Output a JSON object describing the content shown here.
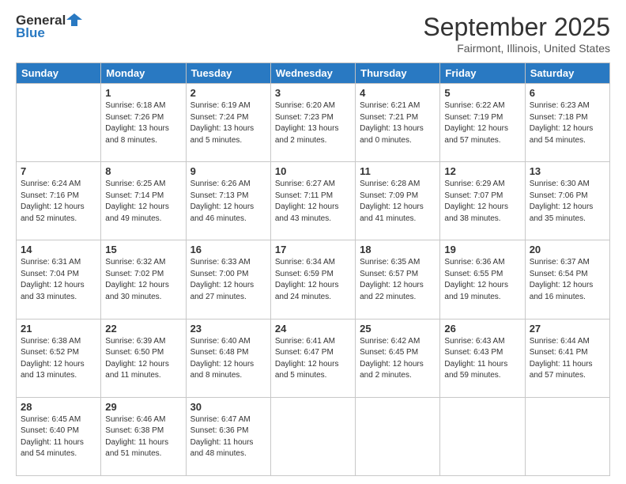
{
  "header": {
    "logo_general": "General",
    "logo_blue": "Blue",
    "month_title": "September 2025",
    "location": "Fairmont, Illinois, United States"
  },
  "days_of_week": [
    "Sunday",
    "Monday",
    "Tuesday",
    "Wednesday",
    "Thursday",
    "Friday",
    "Saturday"
  ],
  "weeks": [
    [
      {
        "day": "",
        "info": ""
      },
      {
        "day": "1",
        "info": "Sunrise: 6:18 AM\nSunset: 7:26 PM\nDaylight: 13 hours\nand 8 minutes."
      },
      {
        "day": "2",
        "info": "Sunrise: 6:19 AM\nSunset: 7:24 PM\nDaylight: 13 hours\nand 5 minutes."
      },
      {
        "day": "3",
        "info": "Sunrise: 6:20 AM\nSunset: 7:23 PM\nDaylight: 13 hours\nand 2 minutes."
      },
      {
        "day": "4",
        "info": "Sunrise: 6:21 AM\nSunset: 7:21 PM\nDaylight: 13 hours\nand 0 minutes."
      },
      {
        "day": "5",
        "info": "Sunrise: 6:22 AM\nSunset: 7:19 PM\nDaylight: 12 hours\nand 57 minutes."
      },
      {
        "day": "6",
        "info": "Sunrise: 6:23 AM\nSunset: 7:18 PM\nDaylight: 12 hours\nand 54 minutes."
      }
    ],
    [
      {
        "day": "7",
        "info": "Sunrise: 6:24 AM\nSunset: 7:16 PM\nDaylight: 12 hours\nand 52 minutes."
      },
      {
        "day": "8",
        "info": "Sunrise: 6:25 AM\nSunset: 7:14 PM\nDaylight: 12 hours\nand 49 minutes."
      },
      {
        "day": "9",
        "info": "Sunrise: 6:26 AM\nSunset: 7:13 PM\nDaylight: 12 hours\nand 46 minutes."
      },
      {
        "day": "10",
        "info": "Sunrise: 6:27 AM\nSunset: 7:11 PM\nDaylight: 12 hours\nand 43 minutes."
      },
      {
        "day": "11",
        "info": "Sunrise: 6:28 AM\nSunset: 7:09 PM\nDaylight: 12 hours\nand 41 minutes."
      },
      {
        "day": "12",
        "info": "Sunrise: 6:29 AM\nSunset: 7:07 PM\nDaylight: 12 hours\nand 38 minutes."
      },
      {
        "day": "13",
        "info": "Sunrise: 6:30 AM\nSunset: 7:06 PM\nDaylight: 12 hours\nand 35 minutes."
      }
    ],
    [
      {
        "day": "14",
        "info": "Sunrise: 6:31 AM\nSunset: 7:04 PM\nDaylight: 12 hours\nand 33 minutes."
      },
      {
        "day": "15",
        "info": "Sunrise: 6:32 AM\nSunset: 7:02 PM\nDaylight: 12 hours\nand 30 minutes."
      },
      {
        "day": "16",
        "info": "Sunrise: 6:33 AM\nSunset: 7:00 PM\nDaylight: 12 hours\nand 27 minutes."
      },
      {
        "day": "17",
        "info": "Sunrise: 6:34 AM\nSunset: 6:59 PM\nDaylight: 12 hours\nand 24 minutes."
      },
      {
        "day": "18",
        "info": "Sunrise: 6:35 AM\nSunset: 6:57 PM\nDaylight: 12 hours\nand 22 minutes."
      },
      {
        "day": "19",
        "info": "Sunrise: 6:36 AM\nSunset: 6:55 PM\nDaylight: 12 hours\nand 19 minutes."
      },
      {
        "day": "20",
        "info": "Sunrise: 6:37 AM\nSunset: 6:54 PM\nDaylight: 12 hours\nand 16 minutes."
      }
    ],
    [
      {
        "day": "21",
        "info": "Sunrise: 6:38 AM\nSunset: 6:52 PM\nDaylight: 12 hours\nand 13 minutes."
      },
      {
        "day": "22",
        "info": "Sunrise: 6:39 AM\nSunset: 6:50 PM\nDaylight: 12 hours\nand 11 minutes."
      },
      {
        "day": "23",
        "info": "Sunrise: 6:40 AM\nSunset: 6:48 PM\nDaylight: 12 hours\nand 8 minutes."
      },
      {
        "day": "24",
        "info": "Sunrise: 6:41 AM\nSunset: 6:47 PM\nDaylight: 12 hours\nand 5 minutes."
      },
      {
        "day": "25",
        "info": "Sunrise: 6:42 AM\nSunset: 6:45 PM\nDaylight: 12 hours\nand 2 minutes."
      },
      {
        "day": "26",
        "info": "Sunrise: 6:43 AM\nSunset: 6:43 PM\nDaylight: 11 hours\nand 59 minutes."
      },
      {
        "day": "27",
        "info": "Sunrise: 6:44 AM\nSunset: 6:41 PM\nDaylight: 11 hours\nand 57 minutes."
      }
    ],
    [
      {
        "day": "28",
        "info": "Sunrise: 6:45 AM\nSunset: 6:40 PM\nDaylight: 11 hours\nand 54 minutes."
      },
      {
        "day": "29",
        "info": "Sunrise: 6:46 AM\nSunset: 6:38 PM\nDaylight: 11 hours\nand 51 minutes."
      },
      {
        "day": "30",
        "info": "Sunrise: 6:47 AM\nSunset: 6:36 PM\nDaylight: 11 hours\nand 48 minutes."
      },
      {
        "day": "",
        "info": ""
      },
      {
        "day": "",
        "info": ""
      },
      {
        "day": "",
        "info": ""
      },
      {
        "day": "",
        "info": ""
      }
    ]
  ]
}
